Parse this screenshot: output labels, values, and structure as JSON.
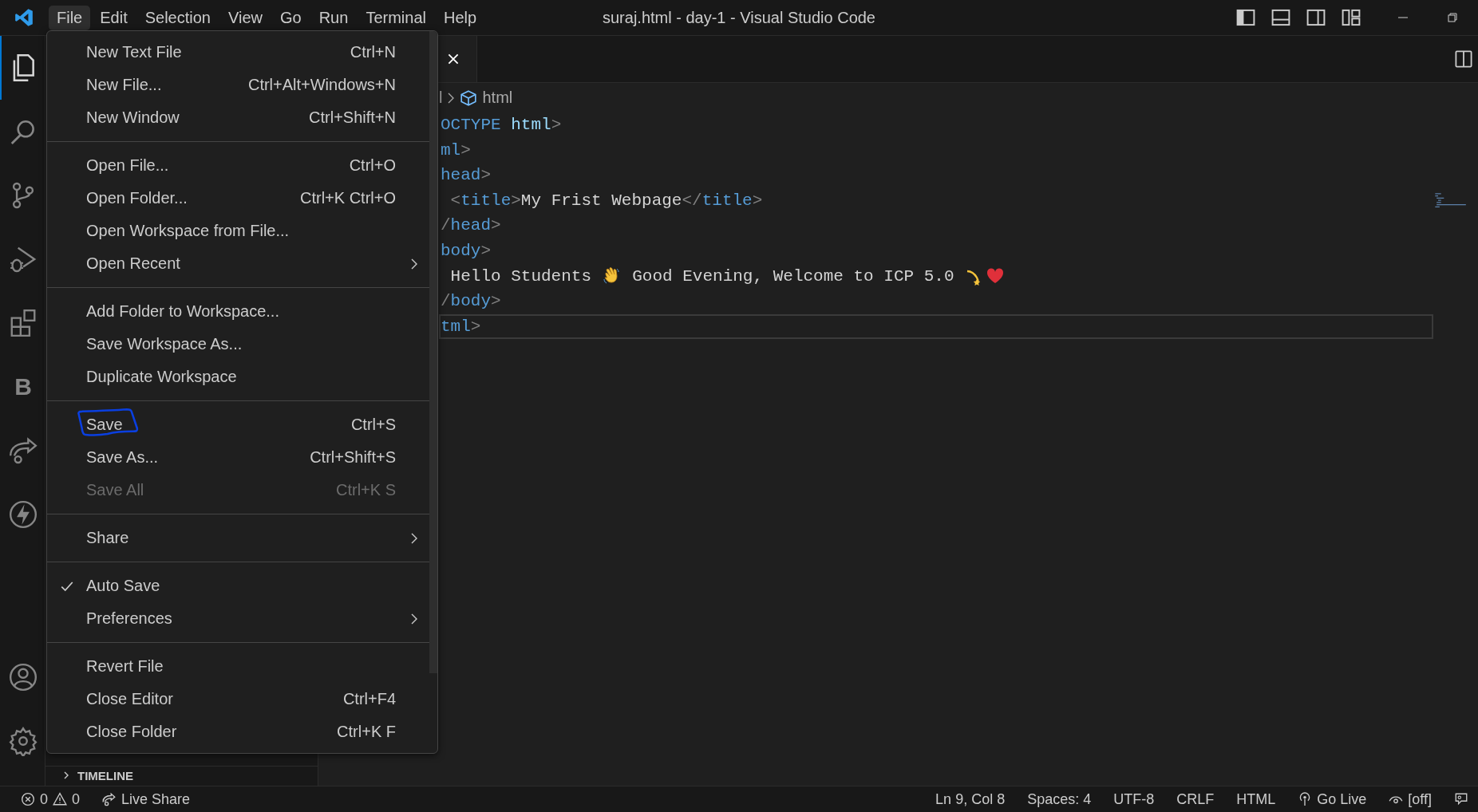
{
  "window": {
    "title": "suraj.html - day-1 - Visual Studio Code"
  },
  "menubar": [
    {
      "label": "File",
      "selected": true
    },
    {
      "label": "Edit",
      "selected": false
    },
    {
      "label": "Selection",
      "selected": false
    },
    {
      "label": "View",
      "selected": false
    },
    {
      "label": "Go",
      "selected": false
    },
    {
      "label": "Run",
      "selected": false
    },
    {
      "label": "Terminal",
      "selected": false
    },
    {
      "label": "Help",
      "selected": false
    }
  ],
  "activity_bar": [
    {
      "selected": true
    },
    {
      "selected": false
    },
    {
      "selected": false
    },
    {
      "selected": false
    },
    {
      "selected": false
    },
    {
      "selected": false,
      "label": "B"
    },
    {
      "selected": false
    },
    {
      "selected": false
    }
  ],
  "menu": [
    {
      "kind": "item",
      "label": "New Text File",
      "shortcut": "Ctrl+N",
      "submenu": false,
      "disabled": false,
      "checked": false,
      "circled": false
    },
    {
      "kind": "item",
      "label": "New File...",
      "shortcut": "Ctrl+Alt+Windows+N",
      "submenu": false,
      "disabled": false,
      "checked": false,
      "circled": false
    },
    {
      "kind": "item",
      "label": "New Window",
      "shortcut": "Ctrl+Shift+N",
      "submenu": false,
      "disabled": false,
      "checked": false,
      "circled": false
    },
    {
      "kind": "separator"
    },
    {
      "kind": "item",
      "label": "Open File...",
      "shortcut": "Ctrl+O",
      "submenu": false,
      "disabled": false,
      "checked": false,
      "circled": false
    },
    {
      "kind": "item",
      "label": "Open Folder...",
      "shortcut": "Ctrl+K Ctrl+O",
      "submenu": false,
      "disabled": false,
      "checked": false,
      "circled": false
    },
    {
      "kind": "item",
      "label": "Open Workspace from File...",
      "submenu": false,
      "disabled": false,
      "checked": false,
      "circled": false
    },
    {
      "kind": "item",
      "label": "Open Recent",
      "submenu": true,
      "disabled": false,
      "checked": false,
      "circled": false
    },
    {
      "kind": "separator"
    },
    {
      "kind": "item",
      "label": "Add Folder to Workspace...",
      "submenu": false,
      "disabled": false,
      "checked": false,
      "circled": false
    },
    {
      "kind": "item",
      "label": "Save Workspace As...",
      "submenu": false,
      "disabled": false,
      "checked": false,
      "circled": false
    },
    {
      "kind": "item",
      "label": "Duplicate Workspace",
      "submenu": false,
      "disabled": false,
      "checked": false,
      "circled": false
    },
    {
      "kind": "separator"
    },
    {
      "kind": "item",
      "label": "Save",
      "shortcut": "Ctrl+S",
      "submenu": false,
      "disabled": false,
      "checked": false,
      "circled": true
    },
    {
      "kind": "item",
      "label": "Save As...",
      "shortcut": "Ctrl+Shift+S",
      "submenu": false,
      "disabled": false,
      "checked": false,
      "circled": false
    },
    {
      "kind": "item",
      "label": "Save All",
      "shortcut": "Ctrl+K S",
      "submenu": false,
      "disabled": true,
      "checked": false,
      "circled": false
    },
    {
      "kind": "separator"
    },
    {
      "kind": "item",
      "label": "Share",
      "submenu": true,
      "disabled": false,
      "checked": false,
      "circled": false
    },
    {
      "kind": "separator"
    },
    {
      "kind": "item",
      "label": "Auto Save",
      "submenu": false,
      "disabled": false,
      "checked": true,
      "circled": false
    },
    {
      "kind": "item",
      "label": "Preferences",
      "submenu": true,
      "disabled": false,
      "checked": false,
      "circled": false
    },
    {
      "kind": "separator"
    },
    {
      "kind": "item",
      "label": "Revert File",
      "submenu": false,
      "disabled": false,
      "checked": false,
      "circled": false
    },
    {
      "kind": "item",
      "label": "Close Editor",
      "shortcut": "Ctrl+F4",
      "submenu": false,
      "disabled": false,
      "checked": false,
      "circled": false
    },
    {
      "kind": "item",
      "label": "Close Folder",
      "shortcut": "Ctrl+K F",
      "submenu": false,
      "disabled": false,
      "checked": false,
      "circled": false
    }
  ],
  "sidebar": {
    "section": "TIMELINE",
    "expanded": false
  },
  "breadcrumb": [
    "l",
    "html"
  ],
  "code": [
    {
      "current": false,
      "tokens": [
        {
          "kind": "tag",
          "text": "OCTYPE"
        },
        {
          "kind": "attr",
          "text": " html"
        },
        {
          "kind": "punct",
          "text": ">"
        }
      ]
    },
    {
      "current": false,
      "tokens": [
        {
          "kind": "tag",
          "text": "ml"
        },
        {
          "kind": "punct",
          "text": ">"
        }
      ]
    },
    {
      "current": false,
      "tokens": [
        {
          "kind": "tag",
          "text": "head"
        },
        {
          "kind": "punct",
          "text": ">"
        }
      ]
    },
    {
      "current": false,
      "tokens": [
        {
          "kind": "punct",
          "text": " <"
        },
        {
          "kind": "tag",
          "text": "title"
        },
        {
          "kind": "punct",
          "text": ">"
        },
        {
          "kind": "text",
          "text": "My Frist Webpage"
        },
        {
          "kind": "punct",
          "text": "</"
        },
        {
          "kind": "tag",
          "text": "title"
        },
        {
          "kind": "punct",
          "text": ">"
        }
      ]
    },
    {
      "current": false,
      "tokens": [
        {
          "kind": "punct",
          "text": "/"
        },
        {
          "kind": "tag",
          "text": "head"
        },
        {
          "kind": "punct",
          "text": ">"
        }
      ]
    },
    {
      "current": false,
      "tokens": [
        {
          "kind": "tag",
          "text": "body"
        },
        {
          "kind": "punct",
          "text": ">"
        }
      ]
    },
    {
      "current": false,
      "tokens": [
        {
          "kind": "text",
          "text": " Hello Students "
        },
        {
          "kind": "wave"
        },
        {
          "kind": "text",
          "text": " Good Evening, Welcome to ICP 5.0 "
        },
        {
          "kind": "dizzy"
        },
        {
          "kind": "heart"
        }
      ]
    },
    {
      "current": false,
      "tokens": [
        {
          "kind": "punct",
          "text": "/"
        },
        {
          "kind": "tag",
          "text": "body"
        },
        {
          "kind": "punct",
          "text": ">"
        }
      ]
    },
    {
      "current": true,
      "tokens": [
        {
          "kind": "tag",
          "text": "tml"
        },
        {
          "kind": "punct",
          "text": ">"
        }
      ]
    }
  ],
  "status_bar": {
    "errors": "0",
    "warnings": "0",
    "live_share": "Live Share",
    "items": [
      "Ln 9, Col 8",
      "Spaces: 4",
      "UTF-8",
      "CRLF",
      "HTML"
    ],
    "go_live": "Go Live",
    "preview": "[off]"
  }
}
